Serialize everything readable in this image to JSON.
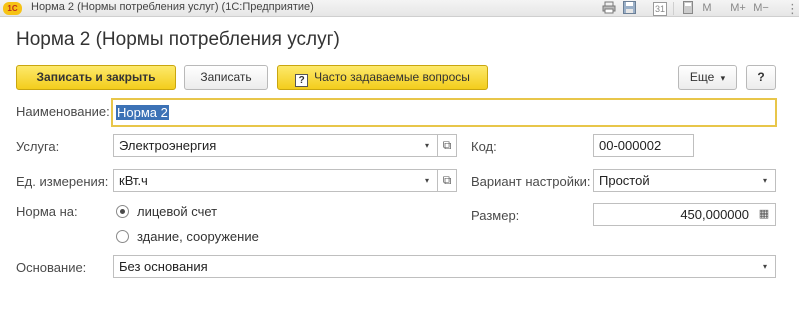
{
  "window": {
    "logo": "1С",
    "title": "Норма 2 (Нормы потребления услуг)  (1С:Предприятие)",
    "tools": {
      "print_icon": "printer-icon",
      "save_icon": "floppy-icon",
      "calendar_icon": "calendar-icon",
      "calendar_day": "31",
      "calculator_icon": "calculator-icon",
      "m": "M",
      "m_plus": "M+",
      "m_minus": "M−",
      "min": "−",
      "max": "□",
      "more": "⋮",
      "close": "×"
    }
  },
  "form": {
    "title": "Норма 2 (Нормы потребления услуг)"
  },
  "toolbar": {
    "save_close_label": "Записать и закрыть",
    "save_label": "Записать",
    "faq_label": "Часто задаваемые вопросы",
    "faq_icon": "?",
    "more_label": "Еще",
    "more_arrow": "▾",
    "help_label": "?"
  },
  "fields": {
    "name_label": "Наименование:",
    "name_value": "Норма 2",
    "service_label": "Услуга:",
    "service_value": "Электроэнергия",
    "code_label": "Код:",
    "code_value": "00-000002",
    "unit_label": "Ед. измерения:",
    "unit_value": "кВт.ч",
    "variant_label": "Вариант настройки:",
    "variant_value": "Простой",
    "norm_label": "Норма на:",
    "norm_options": [
      "лицевой счет",
      "здание, сооружение"
    ],
    "norm_selected": "лицевой счет",
    "size_label": "Размер:",
    "size_value": "450,000000",
    "basis_label": "Основание:",
    "basis_value": "Без основания"
  },
  "icons": {
    "dropdown": "▾",
    "open": "⧉",
    "calculator": "▦"
  }
}
